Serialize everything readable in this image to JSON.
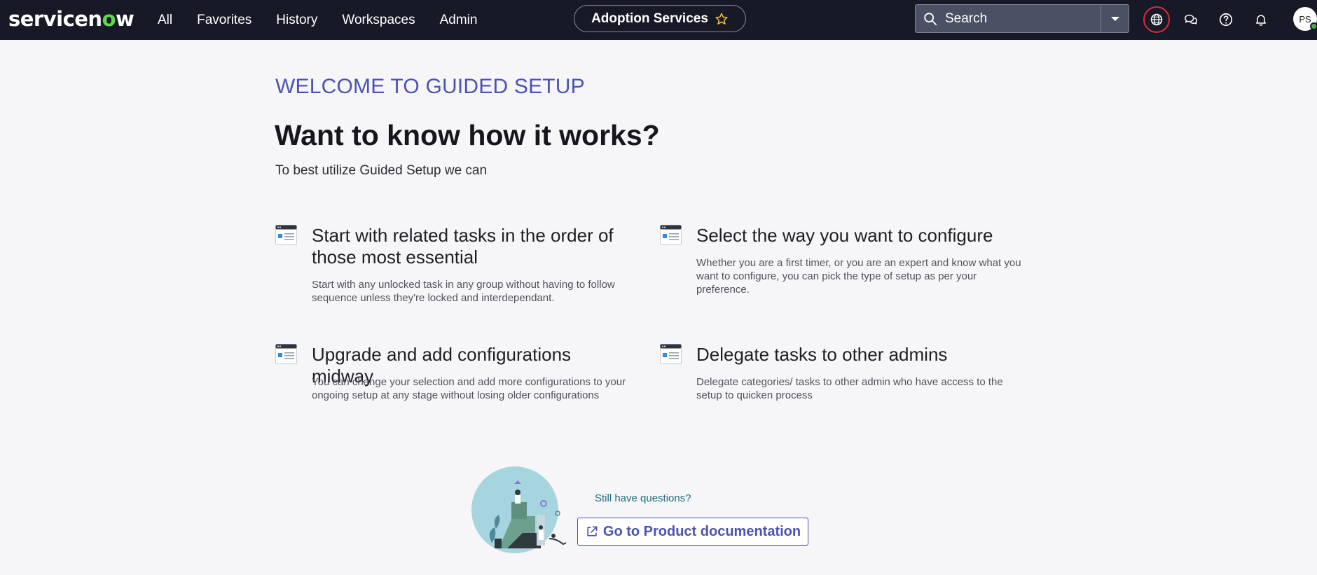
{
  "brand": {
    "logo_pre": "servicen",
    "logo_o": "o",
    "logo_post": "w"
  },
  "nav": {
    "links": [
      "All",
      "Favorites",
      "History",
      "Workspaces",
      "Admin"
    ]
  },
  "header": {
    "app_title": "Adoption Services"
  },
  "search": {
    "placeholder": "Search"
  },
  "user": {
    "initials": "PS"
  },
  "icons": {
    "globe": "globe-icon",
    "chat": "chat-icon",
    "help": "help-icon",
    "bell": "bell-icon",
    "star": "star-icon"
  },
  "colors": {
    "nav_bg": "#171a26",
    "accent": "#4c52b5",
    "brand_green": "#62d84e",
    "highlight_ring": "#e02a3a"
  },
  "main": {
    "kicker": "WELCOME TO GUIDED SETUP",
    "title": "Want to know how it works?",
    "subtitle": "To best utilize Guided Setup we can",
    "features": [
      {
        "title": "Start with related tasks in the order of those most essential",
        "desc": "Start with any unlocked task in any group without having to follow sequence unless they're locked and interdependant."
      },
      {
        "title": "Select the way you want to configure",
        "desc": "Whether you are a first timer, or you are an expert and know what you want to configure, you can pick the type of setup as per your preference."
      },
      {
        "title": "Upgrade and add configurations midway",
        "desc": "You can change your selection and add more configurations to your ongoing setup at any stage without losing older configurations"
      },
      {
        "title": "Delegate tasks to other admins",
        "desc": "Delegate categories/ tasks to other admin who have access to the setup to quicken process"
      }
    ],
    "help": {
      "question": "Still have questions?",
      "button": "Go to Product documentation"
    }
  }
}
